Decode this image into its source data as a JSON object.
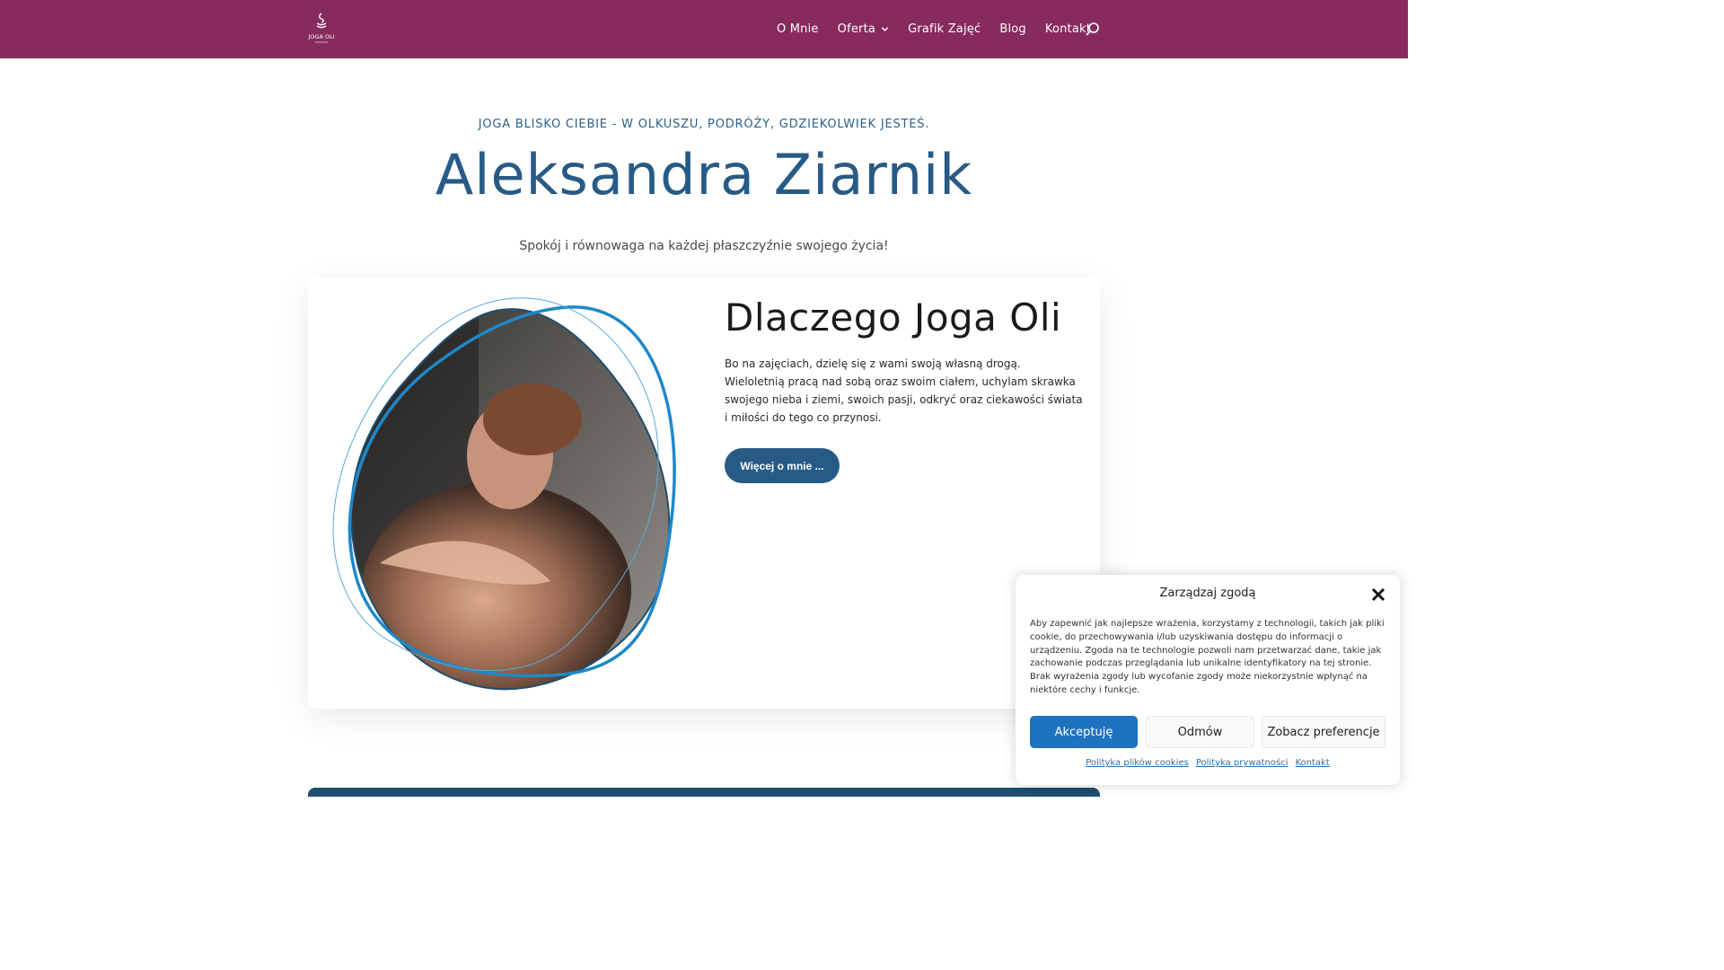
{
  "header": {
    "logo_text": "JOGA OLI",
    "nav": [
      {
        "label": "O Mnie"
      },
      {
        "label": "Oferta"
      },
      {
        "label": "Grafik Zajęć"
      },
      {
        "label": "Blog"
      },
      {
        "label": "Kontakt"
      }
    ],
    "search_icon": "search-icon"
  },
  "hero": {
    "eyebrow": "JOGA BLISKO CIEBIE - W OLKUSZU, PODRÓŻY, GDZIEKOLWIEK JESTEŚ.",
    "title": "Aleksandra Ziarnik",
    "subtitle": "Spokój i równowaga na każdej płaszczyźnie swojego życia!"
  },
  "about_card": {
    "title": "Dlaczego Joga Oli",
    "text": "Bo na zajęciach, dzielę się z wami swoją własną drogą. Wieloletnią pracą nad sobą oraz swoim ciałem, uchylam skrawka swojego nieba i ziemi, swoich pasji, odkryć oraz ciekawości świata i miłości do tego co przynosi.",
    "button": "Więcej o mnie ..."
  },
  "cookie_dialog": {
    "title": "Zarządzaj zgodą",
    "text": "Aby zapewnić jak najlepsze wrażenia, korzystamy z technologii, takich jak pliki cookie, do przechowywania i/lub uzyskiwania dostępu do informacji o urządzeniu. Zgoda na te technologie pozwoli nam przetwarzać dane, takie jak zachowanie podczas przeglądania lub unikalne identyfikatory na tej stronie. Brak wyrażenia zgody lub wycofanie zgody może niekorzystnie wpłynąć na niektóre cechy i funkcje.",
    "accept": "Akceptuję",
    "deny": "Odmów",
    "preferences": "Zobacz preferencje",
    "links": [
      "Polityka plików cookies",
      "Polityka prywatności",
      "Kontakt"
    ]
  },
  "colors": {
    "header_bg": "#872b5e",
    "accent_blue": "#275b85",
    "cookie_accept": "#1e73be"
  }
}
